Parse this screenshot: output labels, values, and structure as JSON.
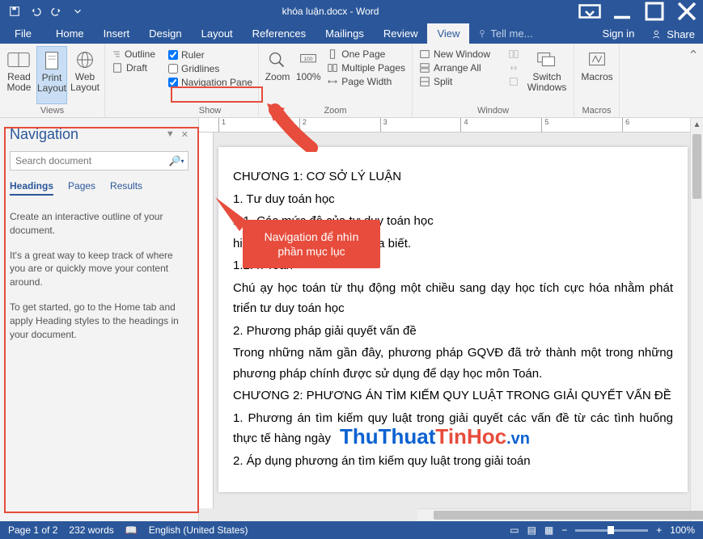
{
  "title": "khóa luận.docx - Word",
  "tabs": {
    "file": "File",
    "home": "Home",
    "insert": "Insert",
    "design": "Design",
    "layout": "Layout",
    "references": "References",
    "mailings": "Mailings",
    "review": "Review",
    "view": "View",
    "tellme": "Tell me...",
    "signin": "Sign in",
    "share": "Share"
  },
  "ribbon": {
    "views": {
      "read": "Read Mode",
      "print": "Print Layout",
      "web": "Web Layout",
      "outline": "Outline",
      "draft": "Draft",
      "label": "Views"
    },
    "show": {
      "ruler": "Ruler",
      "gridlines": "Gridlines",
      "navpane": "Navigation Pane",
      "label": "Show"
    },
    "zoom": {
      "zoom": "Zoom",
      "hundred": "100%",
      "onepage": "One Page",
      "multi": "Multiple Pages",
      "width": "Page Width",
      "label": "Zoom"
    },
    "window": {
      "newwin": "New Window",
      "arrange": "Arrange All",
      "split": "Split",
      "switch": "Switch Windows",
      "label": "Window"
    },
    "macros": {
      "macros": "Macros",
      "label": "Macros"
    }
  },
  "nav": {
    "title": "Navigation",
    "placeholder": "Search document",
    "tabs": {
      "headings": "Headings",
      "pages": "Pages",
      "results": "Results"
    },
    "help": {
      "p1": "Create an interactive outline of your document.",
      "p2": "It's a great way to keep track of where you are or quickly move your content around.",
      "p3": "To get started, go to the Home tab and apply Heading styles to the headings in your document."
    }
  },
  "callout": "Navigation để nhìn phần mục lục",
  "doc": {
    "l1": "CHƯƠNG 1: CƠ SỞ LÝ LUẬN",
    "l2": "1. Tư duy toán học",
    "l3": "1.1. Các mức độ của tư duy toán học",
    "l4": "                                                      hiểu cái mà con người chưa biết.",
    "l5": "1.2.                                                  n Toán",
    "l6": "Chú                                              ạy học toán từ thụ động một chiều sang dạy học tích cực hóa nhằm phát triển tư duy toán học",
    "l7": "2. Phương pháp giải quyết vấn đề",
    "l8": "Trong những năm gần đây, phương pháp GQVĐ đã trở thành một trong những phương pháp chính được sử dụng để dạy học môn Toán.",
    "l9": "CHƯƠNG 2: PHƯƠNG ÁN TÌM KIẾM QUY LUẬT TRONG GIẢI QUYẾT VẤN ĐỀ",
    "l10": "1. Phương án tìm kiếm quy luật trong giải quyết các vấn đề từ các tình huống thực tế hàng ngày",
    "l11": "2. Áp dụng phương án tìm kiếm quy luật trong giải toán"
  },
  "status": {
    "page": "Page 1 of 2",
    "words": "232 words",
    "lang": "English (United States)",
    "zoom": "100%"
  },
  "watermark": {
    "a": "ThuThuat",
    "b": "TinHoc",
    "c": ".vn"
  }
}
